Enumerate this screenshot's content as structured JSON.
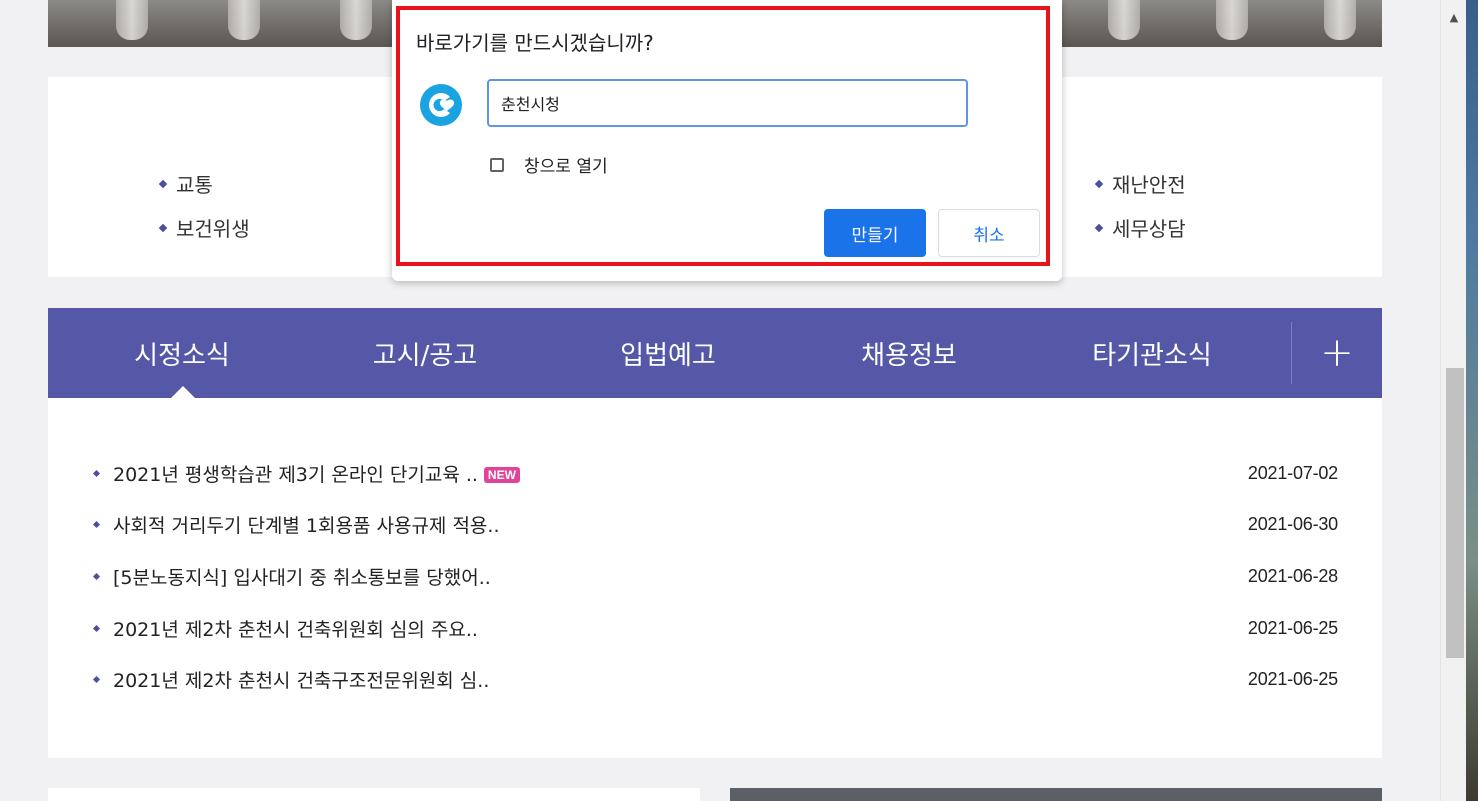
{
  "categories": {
    "left": [
      "교통",
      "보건위생"
    ],
    "right": [
      "재난안전",
      "세무상담"
    ]
  },
  "tabs": {
    "items": [
      "시정소식",
      "고시/공고",
      "입법예고",
      "채용정보",
      "타기관소식"
    ],
    "active": "시정소식",
    "more_label": "+"
  },
  "news": [
    {
      "title": "2021년 평생학습관 제3기 온라인 단기교육 ..",
      "badge": "NEW",
      "date": "2021-07-02"
    },
    {
      "title": "사회적 거리두기 단계별 1회용품 사용규제 적용..",
      "date": "2021-06-30"
    },
    {
      "title": "[5분노동지식] 입사대기 중 취소통보를 당했어..",
      "date": "2021-06-28"
    },
    {
      "title": "2021년 제2차 춘천시 건축위원회 심의 주요..",
      "date": "2021-06-25"
    },
    {
      "title": "2021년 제2차 춘천시 건축구조전문위원회 심..",
      "date": "2021-06-25"
    }
  ],
  "dialog": {
    "title": "바로가기를 만드시겠습니까?",
    "input_value": "춘천시청",
    "open_as_window_label": "창으로 열기",
    "open_as_window_checked": false,
    "create_label": "만들기",
    "cancel_label": "취소",
    "highlight_color": "#e8141b",
    "app_icon": "chuncheon-logo-icon"
  },
  "colors": {
    "tab_bar": "#5558a6",
    "primary_button": "#1a73e8",
    "new_badge": "#e0449a",
    "bullet": "#4a4fa0"
  },
  "scrollbar": {
    "up_arrow": "▲"
  }
}
